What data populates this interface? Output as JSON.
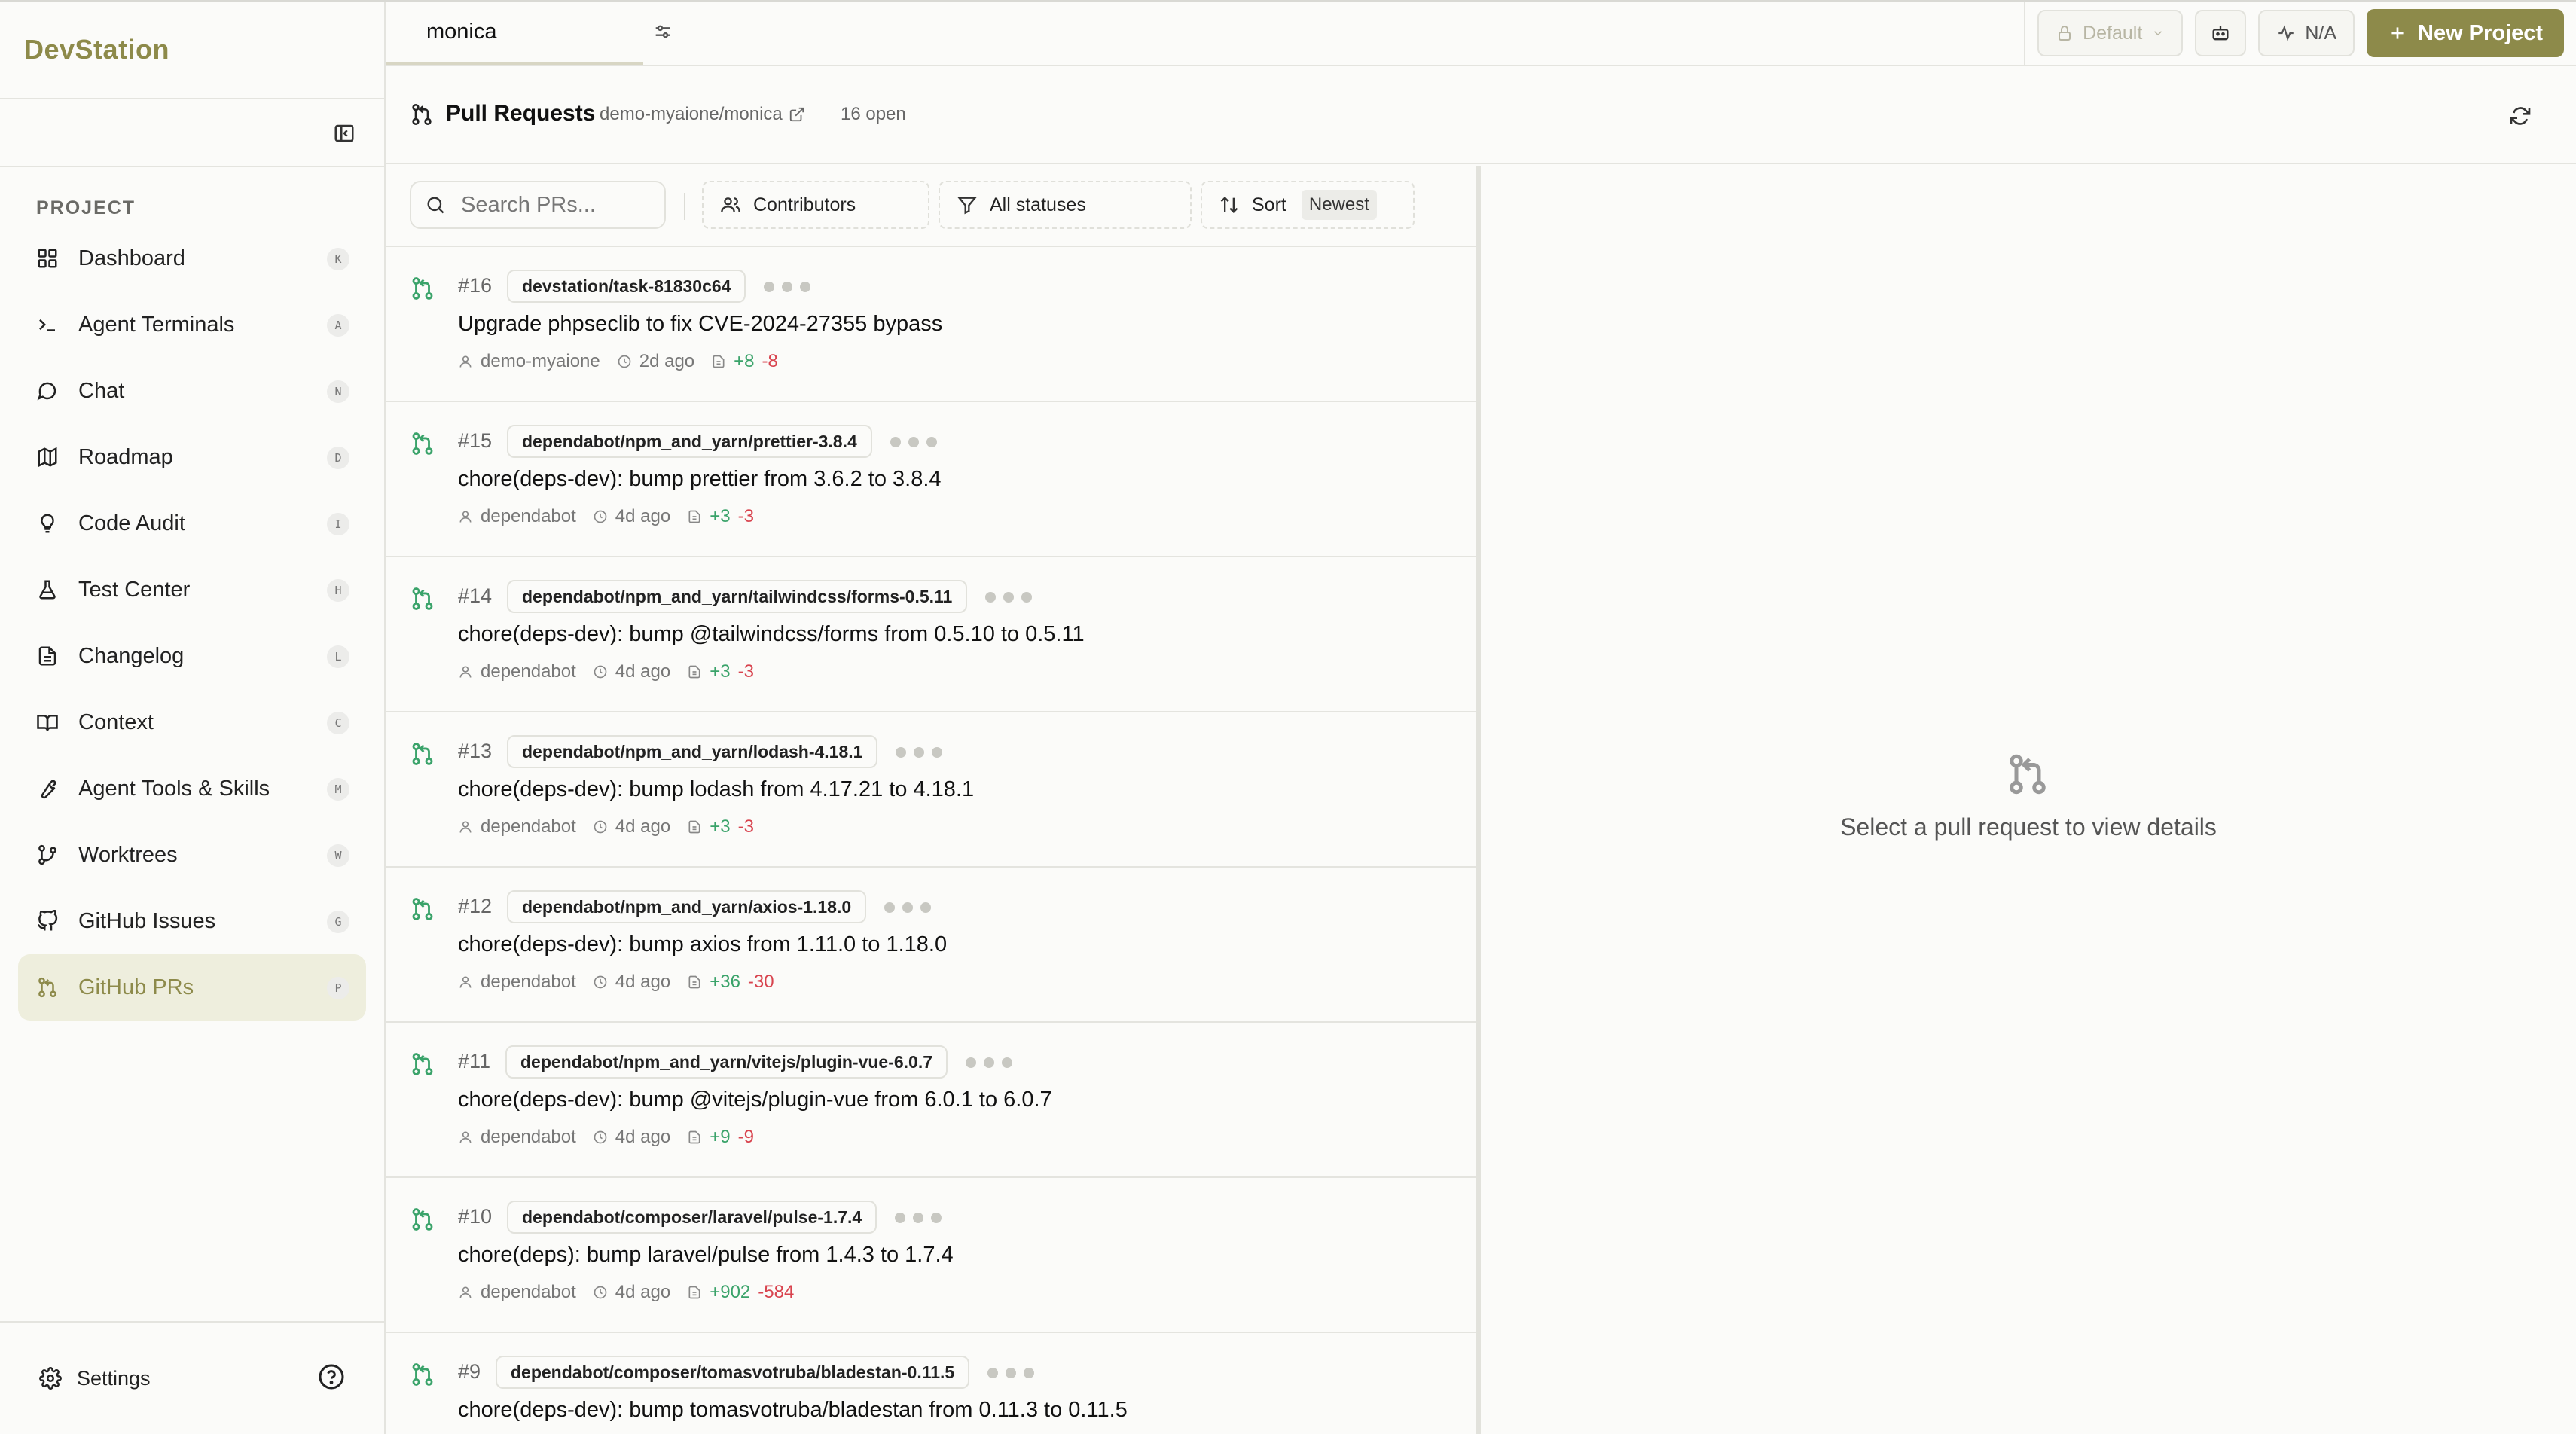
{
  "brand": "DevStation",
  "sidebar": {
    "section": "PROJECT",
    "items": [
      {
        "label": "Dashboard",
        "key": "K",
        "icon": "grid-icon"
      },
      {
        "label": "Agent Terminals",
        "key": "A",
        "icon": "terminal-icon"
      },
      {
        "label": "Chat",
        "key": "N",
        "icon": "chat-icon"
      },
      {
        "label": "Roadmap",
        "key": "D",
        "icon": "map-icon"
      },
      {
        "label": "Code Audit",
        "key": "I",
        "icon": "lightbulb-icon"
      },
      {
        "label": "Test Center",
        "key": "H",
        "icon": "flask-icon"
      },
      {
        "label": "Changelog",
        "key": "L",
        "icon": "document-icon"
      },
      {
        "label": "Context",
        "key": "C",
        "icon": "book-icon"
      },
      {
        "label": "Agent Tools & Skills",
        "key": "M",
        "icon": "wrench-icon"
      },
      {
        "label": "Worktrees",
        "key": "W",
        "icon": "git-branch-icon"
      },
      {
        "label": "GitHub Issues",
        "key": "G",
        "icon": "github-icon"
      },
      {
        "label": "GitHub PRs",
        "key": "P",
        "icon": "git-pull-request-icon",
        "active": true
      }
    ],
    "settings": "Settings"
  },
  "topbar": {
    "project_tab": "monica",
    "profile": "Default",
    "status": "N/A",
    "new_project": "New Project"
  },
  "page": {
    "title": "Pull Requests",
    "repo": "demo-myaione/monica",
    "count": "16 open"
  },
  "filters": {
    "search_placeholder": "Search PRs...",
    "contributors": "Contributors",
    "statuses": "All statuses",
    "sort": "Sort",
    "sort_value": "Newest"
  },
  "prs": [
    {
      "num": "#16",
      "branch": "devstation/task-81830c64",
      "title": "Upgrade phpseclib to fix CVE-2024-27355 bypass",
      "author": "demo-myaione",
      "age": "2d ago",
      "add": "+8",
      "del": "-8"
    },
    {
      "num": "#15",
      "branch": "dependabot/npm_and_yarn/prettier-3.8.4",
      "title": "chore(deps-dev): bump prettier from 3.6.2 to 3.8.4",
      "author": "dependabot",
      "age": "4d ago",
      "add": "+3",
      "del": "-3"
    },
    {
      "num": "#14",
      "branch": "dependabot/npm_and_yarn/tailwindcss/forms-0.5.11",
      "title": "chore(deps-dev): bump @tailwindcss/forms from 0.5.10 to 0.5.11",
      "author": "dependabot",
      "age": "4d ago",
      "add": "+3",
      "del": "-3"
    },
    {
      "num": "#13",
      "branch": "dependabot/npm_and_yarn/lodash-4.18.1",
      "title": "chore(deps-dev): bump lodash from 4.17.21 to 4.18.1",
      "author": "dependabot",
      "age": "4d ago",
      "add": "+3",
      "del": "-3"
    },
    {
      "num": "#12",
      "branch": "dependabot/npm_and_yarn/axios-1.18.0",
      "title": "chore(deps-dev): bump axios from 1.11.0 to 1.18.0",
      "author": "dependabot",
      "age": "4d ago",
      "add": "+36",
      "del": "-30"
    },
    {
      "num": "#11",
      "branch": "dependabot/npm_and_yarn/vitejs/plugin-vue-6.0.7",
      "title": "chore(deps-dev): bump @vitejs/plugin-vue from 6.0.1 to 6.0.7",
      "author": "dependabot",
      "age": "4d ago",
      "add": "+9",
      "del": "-9"
    },
    {
      "num": "#10",
      "branch": "dependabot/composer/laravel/pulse-1.7.4",
      "title": "chore(deps): bump laravel/pulse from 1.4.3 to 1.7.4",
      "author": "dependabot",
      "age": "4d ago",
      "add": "+902",
      "del": "-584"
    },
    {
      "num": "#9",
      "branch": "dependabot/composer/tomasvotruba/bladestan-0.11.5",
      "title": "chore(deps-dev): bump tomasvotruba/bladestan from 0.11.3 to 0.11.5",
      "author": "dependabot",
      "age": "",
      "add": "",
      "del": ""
    }
  ],
  "detail": {
    "empty_text": "Select a pull request to view details"
  },
  "colors": {
    "accent": "#8d8a4a",
    "pr_green": "#3aa36a",
    "del_red": "#d8434e"
  }
}
